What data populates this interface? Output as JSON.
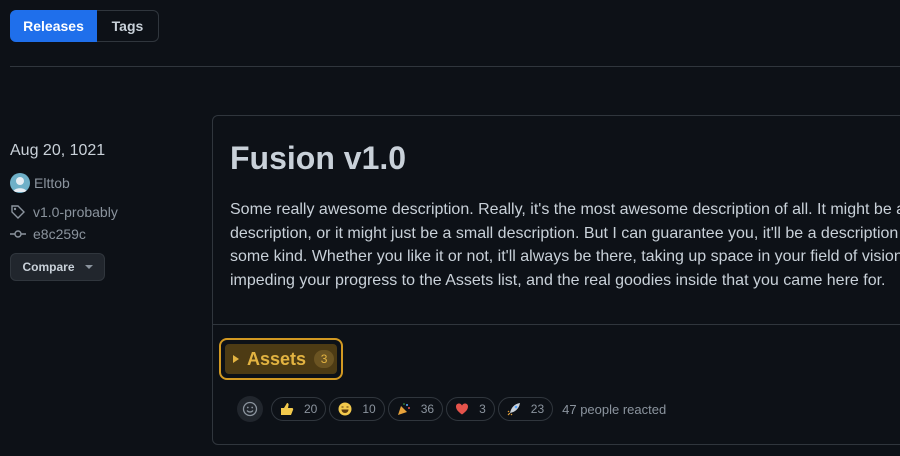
{
  "tabs": {
    "releases": "Releases",
    "tags": "Tags"
  },
  "release": {
    "date": "Aug 20, 1021",
    "author": "Elttob",
    "tag": "v1.0-probably",
    "commit": "e8c259c",
    "compare_label": "Compare",
    "title": "Fusion v1.0",
    "description": "Some really awesome description. Really, it's the most awesome description of all. It might be a long description, or it might just be a small description. But I can guarantee you, it'll be a description of some kind. Whether you like it or not, it'll always be there, taking up space in your field of vision, impeding your progress to the Assets list, and the real goodies inside that you came here for.",
    "assets_label": "Assets",
    "assets_count": "3"
  },
  "reactions": {
    "items": [
      {
        "icon": "thumbs-up-icon",
        "count": "20",
        "color": "#f2c94c"
      },
      {
        "icon": "laugh-icon",
        "count": "10",
        "color": "#f2c94c"
      },
      {
        "icon": "party-popper-icon",
        "count": "36",
        "color": "#e8a23a"
      },
      {
        "icon": "heart-icon",
        "count": "3",
        "color": "#e5534b"
      },
      {
        "icon": "rocket-icon",
        "count": "23",
        "color": "#c9d1d9"
      }
    ],
    "summary": "47 people reacted"
  },
  "colors": {
    "accent": "#1f6feb",
    "focus_ring": "#d29922",
    "assets_bg": "#4d3b14",
    "assets_text": "#e3b341"
  }
}
